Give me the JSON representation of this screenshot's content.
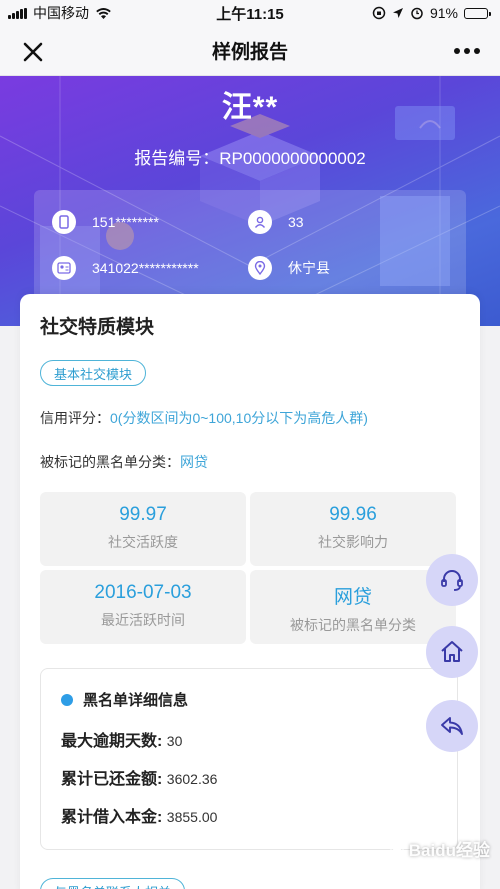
{
  "status_bar": {
    "carrier": "中国移动",
    "time": "上午11:15",
    "battery": "91%",
    "battery_level": 0.91
  },
  "nav": {
    "title": "样例报告"
  },
  "hero": {
    "name": "汪**",
    "report_no": "报告编号：RP0000000000002",
    "phone": "151********",
    "age": "33",
    "id_number": "341022***********",
    "location": "休宁县"
  },
  "module": {
    "title": "社交特质模块",
    "tag": "基本社交模块",
    "credit_label": "信用评分：",
    "credit_value": "0(分数区间为0~100,10分以下为高危人群)",
    "blacklist_label": "被标记的黑名单分类：",
    "blacklist_value": "网贷",
    "tiles": [
      {
        "value": "99.97",
        "label": "社交活跃度"
      },
      {
        "value": "99.96",
        "label": "社交影响力"
      },
      {
        "value": "2016-07-03",
        "label": "最近活跃时间"
      },
      {
        "value": "网贷",
        "label": "被标记的黑名单分类"
      }
    ],
    "detail": {
      "title": "黑名单详细信息",
      "rows": [
        {
          "label": "最大逾期天数:",
          "value": "30"
        },
        {
          "label": "累计已还金额:",
          "value": "3602.36"
        },
        {
          "label": "累计借入本金:",
          "value": "3855.00"
        }
      ]
    },
    "bottom_tag": "与黑名单联系人相关"
  },
  "watermark": "Baidu经验",
  "colors": {
    "accent": "#2a9fdc",
    "hero_start": "#7a3be0",
    "hero_end": "#3c5bd0",
    "fab": "#d6d6f8"
  }
}
